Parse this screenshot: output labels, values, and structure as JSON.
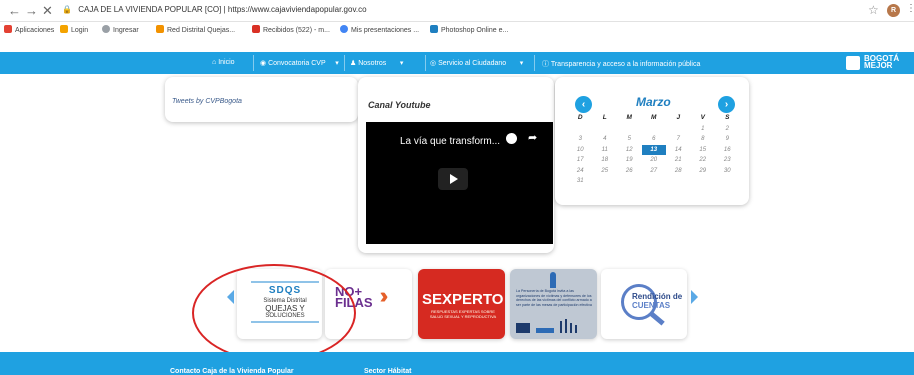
{
  "browser": {
    "address_site": "CAJA DE LA VIVIENDA POPULAR [CO]",
    "address_separator": "|",
    "address_url": "https://www.cajaviviendapopular.gov.co",
    "avatar_letter": "R"
  },
  "bookmarks": [
    {
      "label": "Aplicaciones",
      "icon": "apps-grid-icon",
      "color": "#e34133"
    },
    {
      "label": "Login",
      "icon": "login-icon",
      "color": "#f4a300"
    },
    {
      "label": "Ingresar",
      "icon": "star-icon",
      "color": "#9aa0a6"
    },
    {
      "label": "Red Distrital Quejas...",
      "icon": "rdq-icon",
      "color": "#f29200"
    },
    {
      "label": "Recibidos (522) - m...",
      "icon": "gmail-icon",
      "color": "#d93025"
    },
    {
      "label": "Mis presentaciones ...",
      "icon": "presentations-icon",
      "color": "#4285f4"
    },
    {
      "label": "Photoshop Online e...",
      "icon": "photoshop-icon",
      "color": "#1f7fc0"
    }
  ],
  "nav": {
    "items": [
      {
        "label": "Inicio",
        "icon": "home-icon"
      },
      {
        "label": "Convocatoria CVP",
        "icon": "megaphone-icon"
      },
      {
        "label": "Nosotros",
        "icon": "people-icon"
      },
      {
        "label": "Servicio al Ciudadano",
        "icon": "service-icon"
      },
      {
        "label": "Transparencia y acceso a la información pública",
        "icon": "info-circle-icon"
      }
    ],
    "logo_text": "BOGOTÁ MEJOR",
    "color": "#1fa1e1"
  },
  "tweets": {
    "label": "Tweets by CVPBogota"
  },
  "youtube": {
    "heading": "Canal Youtube",
    "video_title": "La vía que transform..."
  },
  "calendar": {
    "month": "Marzo",
    "prev": "‹",
    "next": "›",
    "weekdays": [
      "D",
      "L",
      "M",
      "M",
      "J",
      "V",
      "S"
    ],
    "weeks": [
      [
        "",
        "",
        "",
        "",
        "",
        "1",
        "2"
      ],
      [
        "3",
        "4",
        "5",
        "6",
        "7",
        "8",
        "9"
      ],
      [
        "10",
        "11",
        "12",
        "13",
        "14",
        "15",
        "16"
      ],
      [
        "17",
        "18",
        "19",
        "20",
        "21",
        "22",
        "23"
      ],
      [
        "24",
        "25",
        "26",
        "27",
        "28",
        "29",
        "30"
      ],
      [
        "31",
        "",
        "",
        "",
        "",
        "",
        ""
      ]
    ],
    "today": "13"
  },
  "carousel": {
    "sdqs": {
      "title": "SDQS",
      "line1": "Sistema Distrital",
      "line2": "QUEJAS Y",
      "line3": "SOLUCIONES"
    },
    "nofilas": {
      "line1": "NO+",
      "line2": "FILAS"
    },
    "sexperto": {
      "title": "SEXPERTO",
      "subtitle": "RESPUESTAS EXPERTAS SOBRE SALUD SEXUAL Y REPRODUCTIVA"
    },
    "personeria": {
      "text": "La Personería de Bogotá invita a las organizaciones de víctimas y defensores de los derechos de las víctimas del conflicto armado a ser parte de las mesas de participación efectiva"
    },
    "rendicion": {
      "line1": "Rendición de",
      "line2": "CUENTAS"
    }
  },
  "footer": {
    "col1": "Contacto Caja de la Vivienda Popular",
    "col2": "Sector Hábitat"
  }
}
